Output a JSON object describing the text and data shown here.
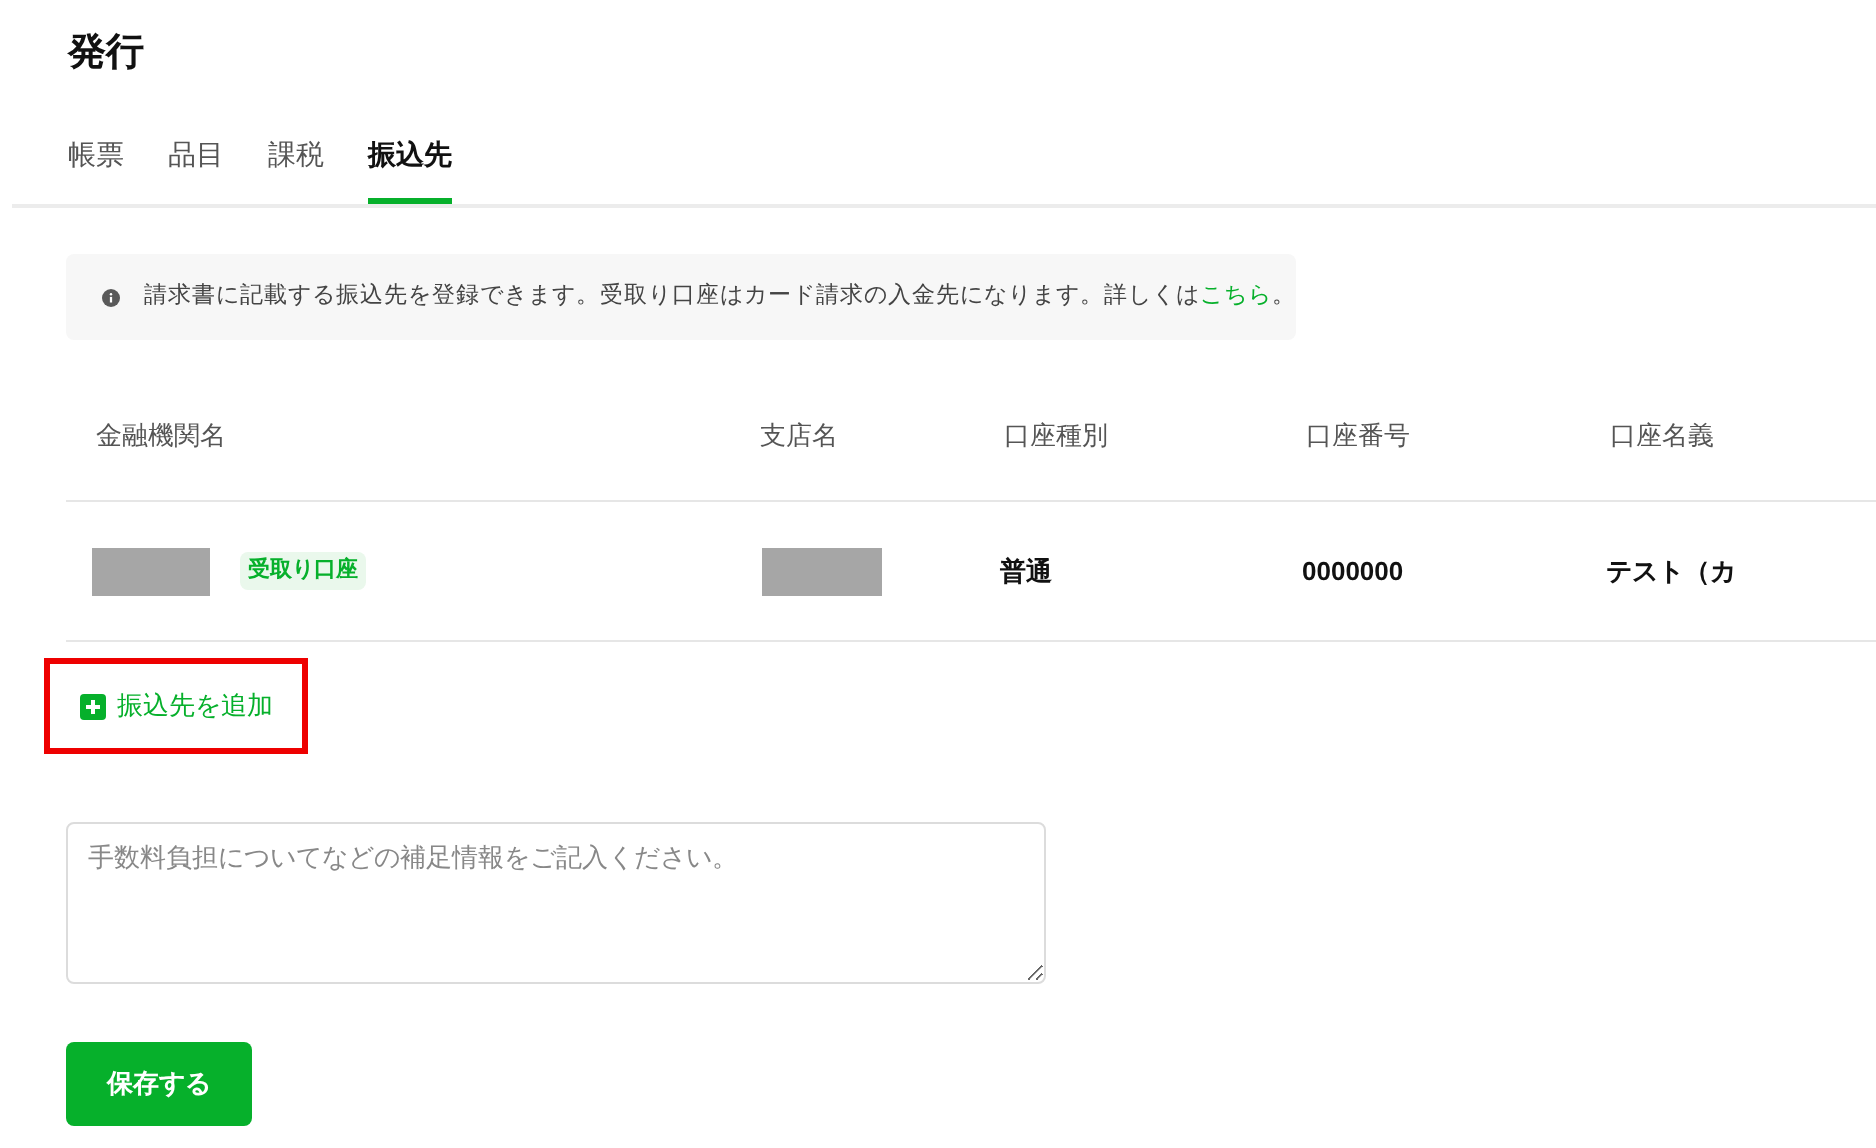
{
  "title": "発行",
  "tabs": [
    {
      "label": "帳票",
      "selected": false
    },
    {
      "label": "品目",
      "selected": false
    },
    {
      "label": "課税",
      "selected": false
    },
    {
      "label": "振込先",
      "selected": true
    }
  ],
  "info": {
    "text": "請求書に記載する振込先を登録できます。受取り口座はカード請求の入金先になります。詳しくは",
    "link": "こちら",
    "end": "。"
  },
  "table": {
    "columns": [
      "金融機関名",
      "支店名",
      "口座種別",
      "口座番号",
      "口座名義"
    ],
    "rows": [
      {
        "bank": {
          "redacted": true,
          "badge": "受取り口座"
        },
        "branch": {
          "redacted": true
        },
        "type": "普通",
        "number": "0000000",
        "holder": "テスト（カ"
      }
    ]
  },
  "add_button": {
    "label": "振込先を追加",
    "highlighted": true
  },
  "note": {
    "placeholder": "手数料負担についてなどの補足情報をご記入ください。"
  },
  "save_button": "保存する"
}
